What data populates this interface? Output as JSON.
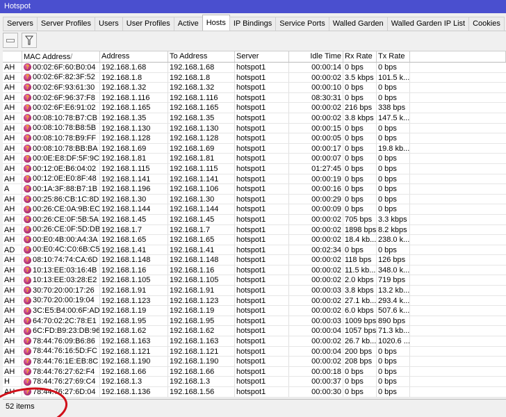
{
  "window": {
    "title": "Hotspot"
  },
  "tabs": [
    "Servers",
    "Server Profiles",
    "Users",
    "User Profiles",
    "Active",
    "Hosts",
    "IP Bindings",
    "Service Ports",
    "Walled Garden",
    "Walled Garden IP List",
    "Cookies"
  ],
  "active_tab": "Hosts",
  "toolbar": {
    "remove_icon": "minus-icon",
    "filter_icon": "funnel-icon"
  },
  "columns": [
    "",
    "MAC Address",
    "Address",
    "To Address",
    "Server",
    "Idle Time",
    "Rx Rate",
    "Tx Rate"
  ],
  "sort_indicator": "/",
  "rows": [
    [
      "AH",
      "00:02:6F:60:B0:04",
      "192.168.1.68",
      "192.168.1.68",
      "hotspot1",
      "00:00:14",
      "0 bps",
      "0 bps"
    ],
    [
      "AH",
      "00:02:6F:82:3F:52",
      "192.168.1.8",
      "192.168.1.8",
      "hotspot1",
      "00:00:02",
      "3.5 kbps",
      "101.5 k..."
    ],
    [
      "AH",
      "00:02:6F:93:61:30",
      "192.168.1.32",
      "192.168.1.32",
      "hotspot1",
      "00:00:10",
      "0 bps",
      "0 bps"
    ],
    [
      "AH",
      "00:02:6F:96:37:F8",
      "192.168.1.116",
      "192.168.1.116",
      "hotspot1",
      "08:30:31",
      "0 bps",
      "0 bps"
    ],
    [
      "AH",
      "00:02:6F:E6:91:02",
      "192.168.1.165",
      "192.168.1.165",
      "hotspot1",
      "00:00:02",
      "216 bps",
      "338 bps"
    ],
    [
      "AH",
      "00:08:10:78:B7:CB",
      "192.168.1.35",
      "192.168.1.35",
      "hotspot1",
      "00:00:02",
      "3.8 kbps",
      "147.5 k..."
    ],
    [
      "AH",
      "00:08:10:78:B8:5B",
      "192.168.1.130",
      "192.168.1.130",
      "hotspot1",
      "00:00:15",
      "0 bps",
      "0 bps"
    ],
    [
      "AH",
      "00:08:10:78:B9:FF",
      "192.168.1.128",
      "192.168.1.128",
      "hotspot1",
      "00:00:05",
      "0 bps",
      "0 bps"
    ],
    [
      "AH",
      "00:08:10:78:BB:BA",
      "192.168.1.69",
      "192.168.1.69",
      "hotspot1",
      "00:00:17",
      "0 bps",
      "19.8 kb..."
    ],
    [
      "AH",
      "00:0E:E8:DF:5F:9C",
      "192.168.1.81",
      "192.168.1.81",
      "hotspot1",
      "00:00:07",
      "0 bps",
      "0 bps"
    ],
    [
      "AH",
      "00:12:0E:B6:04:02",
      "192.168.1.115",
      "192.168.1.115",
      "hotspot1",
      "01:27:45",
      "0 bps",
      "0 bps"
    ],
    [
      "AH",
      "00:12:0E:E0:8F:48",
      "192.168.1.141",
      "192.168.1.141",
      "hotspot1",
      "00:00:19",
      "0 bps",
      "0 bps"
    ],
    [
      "A",
      "00:1A:3F:88:B7:1B",
      "192.168.1.196",
      "192.168.1.106",
      "hotspot1",
      "00:00:16",
      "0 bps",
      "0 bps"
    ],
    [
      "AH",
      "00:25:86:CB:1C:8D",
      "192.168.1.30",
      "192.168.1.30",
      "hotspot1",
      "00:00:29",
      "0 bps",
      "0 bps"
    ],
    [
      "AH",
      "00:26:CE:0A:9B:EC",
      "192.168.1.144",
      "192.168.1.144",
      "hotspot1",
      "00:00:09",
      "0 bps",
      "0 bps"
    ],
    [
      "AH",
      "00:26:CE:0F:5B:5A",
      "192.168.1.45",
      "192.168.1.45",
      "hotspot1",
      "00:00:02",
      "705 bps",
      "3.3 kbps"
    ],
    [
      "AH",
      "00:26:CE:0F:5D:DB",
      "192.168.1.7",
      "192.168.1.7",
      "hotspot1",
      "00:00:02",
      "1898 bps",
      "8.2 kbps"
    ],
    [
      "AH",
      "00:E0:4B:00:A4:3A",
      "192.168.1.65",
      "192.168.1.65",
      "hotspot1",
      "00:00:02",
      "18.4 kb...",
      "238.0 k..."
    ],
    [
      "AD",
      "00:E0:4C:C0:6B:C5",
      "192.168.1.41",
      "192.168.1.41",
      "hotspot1",
      "00:02:34",
      "0 bps",
      "0 bps"
    ],
    [
      "AH",
      "08:10:74:74:CA:6D",
      "192.168.1.148",
      "192.168.1.148",
      "hotspot1",
      "00:00:02",
      "118 bps",
      "126 bps"
    ],
    [
      "AH",
      "10:13:EE:03:16:4B",
      "192.168.1.16",
      "192.168.1.16",
      "hotspot1",
      "00:00:02",
      "11.5 kb...",
      "348.0 k..."
    ],
    [
      "AH",
      "10:13:EE:03:28:E2",
      "192.168.1.105",
      "192.168.1.105",
      "hotspot1",
      "00:00:02",
      "2.0 kbps",
      "719 bps"
    ],
    [
      "AH",
      "30:70:20:00:17:26",
      "192.168.1.91",
      "192.168.1.91",
      "hotspot1",
      "00:00:03",
      "3.8 kbps",
      "13.2 kb..."
    ],
    [
      "AH",
      "30:70:20:00:19:04",
      "192.168.1.123",
      "192.168.1.123",
      "hotspot1",
      "00:00:02",
      "27.1 kb...",
      "293.4 k..."
    ],
    [
      "AH",
      "3C:E5:B4:00:6F:AD",
      "192.168.1.19",
      "192.168.1.19",
      "hotspot1",
      "00:00:02",
      "6.0 kbps",
      "507.6 k..."
    ],
    [
      "AH",
      "64:70:02:2C:78:E1",
      "192.168.1.95",
      "192.168.1.95",
      "hotspot1",
      "00:00:03",
      "1009 bps",
      "890 bps"
    ],
    [
      "AH",
      "6C:FD:B9:23:DB:96",
      "192.168.1.62",
      "192.168.1.62",
      "hotspot1",
      "00:00:04",
      "1057 bps",
      "71.3 kb..."
    ],
    [
      "AH",
      "78:44:76:09:B6:86",
      "192.168.1.163",
      "192.168.1.163",
      "hotspot1",
      "00:00:02",
      "26.7 kb...",
      "1020.6 ..."
    ],
    [
      "AH",
      "78:44:76:16:5D:FC",
      "192.168.1.121",
      "192.168.1.121",
      "hotspot1",
      "00:00:04",
      "200 bps",
      "0 bps"
    ],
    [
      "AH",
      "78:44:76:1E:EB:8C",
      "192.168.1.190",
      "192.168.1.190",
      "hotspot1",
      "00:00:02",
      "208 bps",
      "0 bps"
    ],
    [
      "AH",
      "78:44:76:27:62:F4",
      "192.168.1.66",
      "192.168.1.66",
      "hotspot1",
      "00:00:18",
      "0 bps",
      "0 bps"
    ],
    [
      "H",
      "78:44:76:27:69:C4",
      "192.168.1.3",
      "192.168.1.3",
      "hotspot1",
      "00:00:37",
      "0 bps",
      "0 bps"
    ],
    [
      "AH",
      "78:44:76:27:6D:04",
      "192.168.1.136",
      "192.168.1.56",
      "hotspot1",
      "00:00:30",
      "0 bps",
      "0 bps"
    ]
  ],
  "status_bar": {
    "item_count": "52 items"
  },
  "colors": {
    "title_bar": "#4a4fcf",
    "annotation_circle": "#d0101a"
  }
}
